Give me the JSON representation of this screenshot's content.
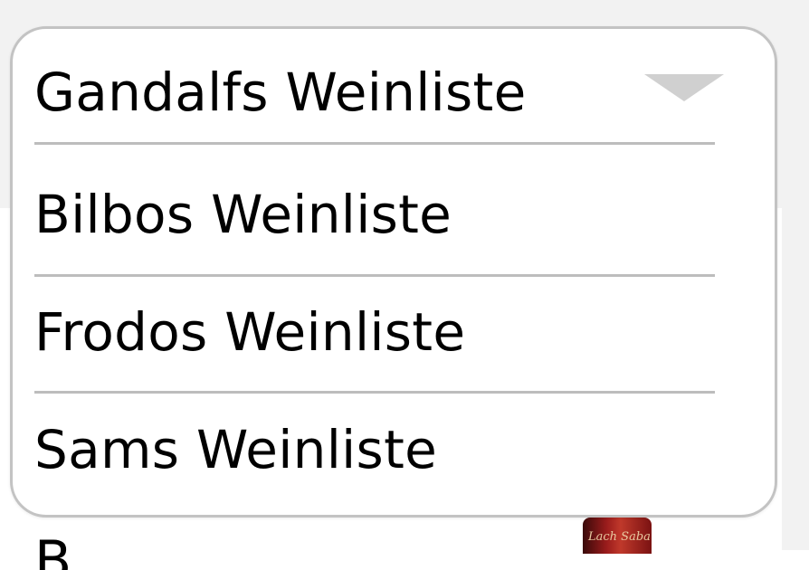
{
  "dropdown": {
    "selected": "Gandalfs Weinliste",
    "options": [
      "Bilbos Weinliste",
      "Frodos Weinliste",
      "Sams Weinliste"
    ],
    "toggle_icon": "chevron-down-icon"
  },
  "background": {
    "heading_fragment": "B",
    "bottle_label": "Lach Saba"
  }
}
